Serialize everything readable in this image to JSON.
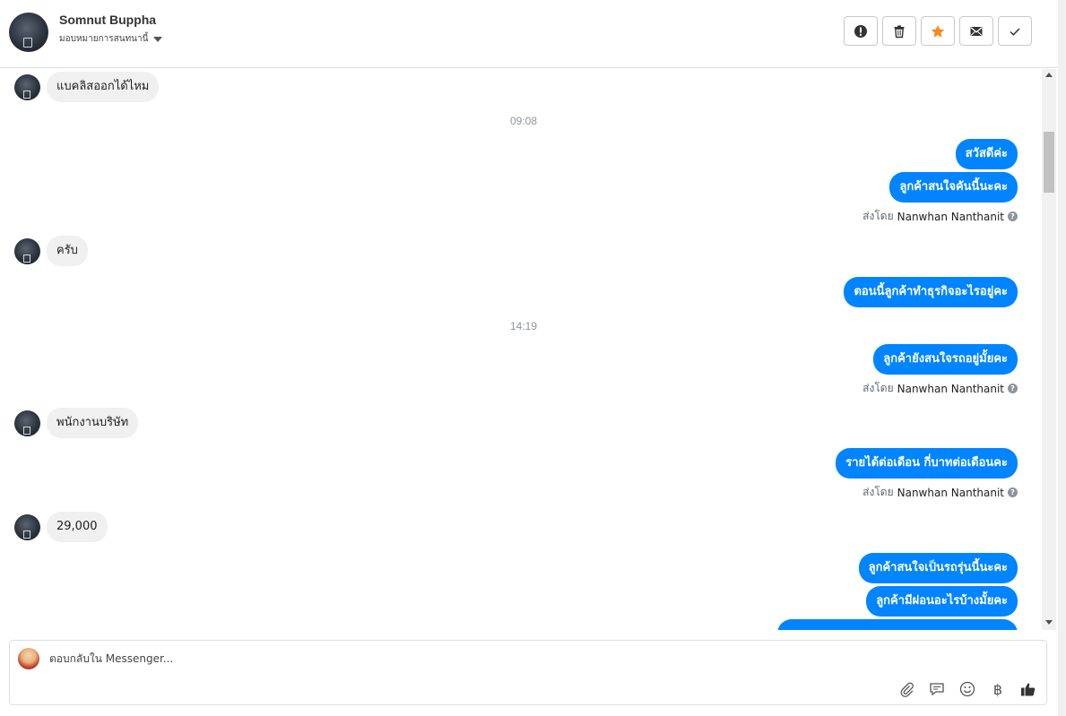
{
  "header": {
    "contact_name": "Somnut Buppha",
    "assign_label": "มอบหมายการสนทนานี้"
  },
  "actions": [
    {
      "name": "mark-spam-button",
      "icon": "exclamation-circle-icon"
    },
    {
      "name": "delete-button",
      "icon": "trash-icon"
    },
    {
      "name": "star-button",
      "icon": "star-icon"
    },
    {
      "name": "mark-unread-button",
      "icon": "envelope-icon"
    },
    {
      "name": "mark-done-button",
      "icon": "check-icon"
    }
  ],
  "colors": {
    "outgoing_bubble": "#0084ff",
    "incoming_bubble": "#f0f0f0",
    "star": "#f68a1e"
  },
  "messages": [
    {
      "type": "in",
      "text": "แบคลิสออกได้ไหม"
    },
    {
      "type": "time",
      "text": "09:08"
    },
    {
      "type": "out",
      "text": "สวัสดีค่ะ"
    },
    {
      "type": "out",
      "text": "ลูกค้าสนใจคันนี้นะคะ"
    },
    {
      "type": "sentby",
      "prefix": "ส่งโดย",
      "name": "Nanwhan Nanthanit"
    },
    {
      "type": "in",
      "text": "ครับ"
    },
    {
      "type": "out",
      "text": "ตอนนี้ลูกค้าทำธุรกิจอะไรอยู่คะ"
    },
    {
      "type": "time",
      "text": "14:19"
    },
    {
      "type": "out",
      "text": "ลูกค้ายังสนใจรถอยู่มั้ยคะ"
    },
    {
      "type": "sentby",
      "prefix": "ส่งโดย",
      "name": "Nanwhan Nanthanit"
    },
    {
      "type": "in",
      "text": "พนักงานบริษัท"
    },
    {
      "type": "out",
      "text": "รายได้ต่อเดือน  กี่บาทต่อเดือนคะ"
    },
    {
      "type": "sentby",
      "prefix": "ส่งโดย",
      "name": "Nanwhan Nanthanit"
    },
    {
      "type": "in",
      "text": "29,000"
    },
    {
      "type": "out",
      "text": "ลูกค้าสนใจเป็นรถรุ่นนี้นะคะ"
    },
    {
      "type": "out",
      "text": "ลูกค้ามีผ่อนอะไรบ้างมั้ยคะ"
    }
  ],
  "composer": {
    "placeholder": "ตอบกลับใน Messenger...",
    "tools": [
      "paperclip-icon",
      "saved-reply-icon",
      "emoji-icon",
      "baht-icon",
      "thumbs-up-icon"
    ]
  }
}
